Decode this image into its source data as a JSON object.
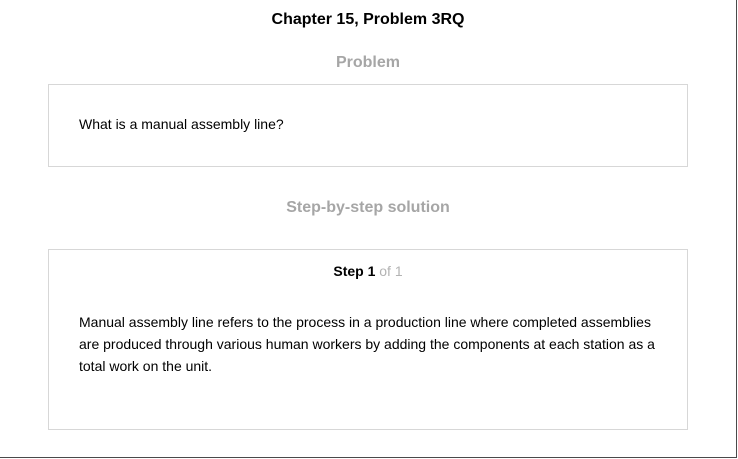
{
  "header": {
    "title": "Chapter 15, Problem 3RQ"
  },
  "problem": {
    "heading": "Problem",
    "text": "What is a manual assembly line?"
  },
  "solution": {
    "heading": "Step-by-step solution",
    "step": {
      "label": "Step 1",
      "of": "of 1",
      "text": "Manual assembly line refers to the process in a production line where completed assemblies are produced through various human workers by adding the components at each station as a total work on the unit."
    }
  },
  "colors": {
    "heading_gray": "#a6a6a6",
    "border": "#d7d7d7",
    "step_of_gray": "#b3b3b3"
  }
}
